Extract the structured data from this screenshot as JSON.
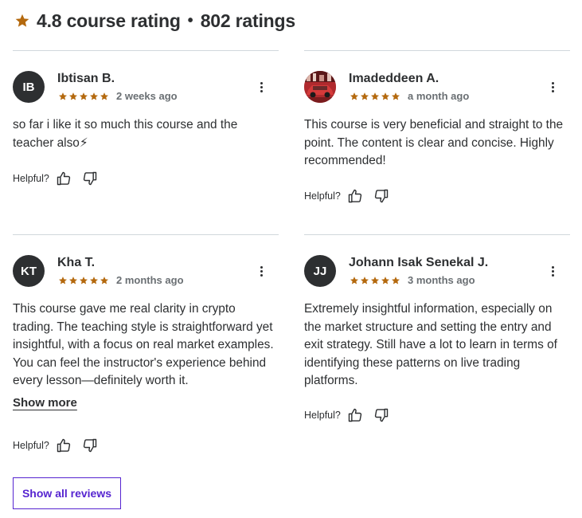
{
  "header": {
    "rating": "4.8 course rating",
    "separator": "•",
    "count": "802 ratings",
    "star_color": "#b4690e"
  },
  "reviews": [
    {
      "initials": "IB",
      "name": "Ibtisan B.",
      "stars": 5,
      "time": "2 weeks ago",
      "text": "so far i like it so much this course and the teacher also⚡",
      "helpful_label": "Helpful?"
    },
    {
      "initials": "",
      "avatar_icon": "car-photo",
      "name": "Imadeddeen A.",
      "stars": 5,
      "time": "a month ago",
      "text": "This course is very beneficial and straight to the point. The content is clear and concise. Highly recommended!",
      "helpful_label": "Helpful?"
    },
    {
      "initials": "KT",
      "name": "Kha T.",
      "stars": 5,
      "time": "2 months ago",
      "text": "This course gave me real clarity in crypto trading. The teaching style is straightforward yet insightful, with a focus on real market examples. You can feel the instructor's experience behind every lesson—definitely worth it.",
      "show_more": "Show more",
      "helpful_label": "Helpful?"
    },
    {
      "initials": "JJ",
      "name": "Johann Isak Senekal J.",
      "stars": 5,
      "time": "3 months ago",
      "text": "Extremely insightful information, especially on the market structure and setting the entry and exit strategy. Still have a lot to learn in terms of identifying these patterns on live trading platforms.",
      "helpful_label": "Helpful?"
    }
  ],
  "show_all_label": "Show all reviews",
  "accent_color": "#5624d0"
}
